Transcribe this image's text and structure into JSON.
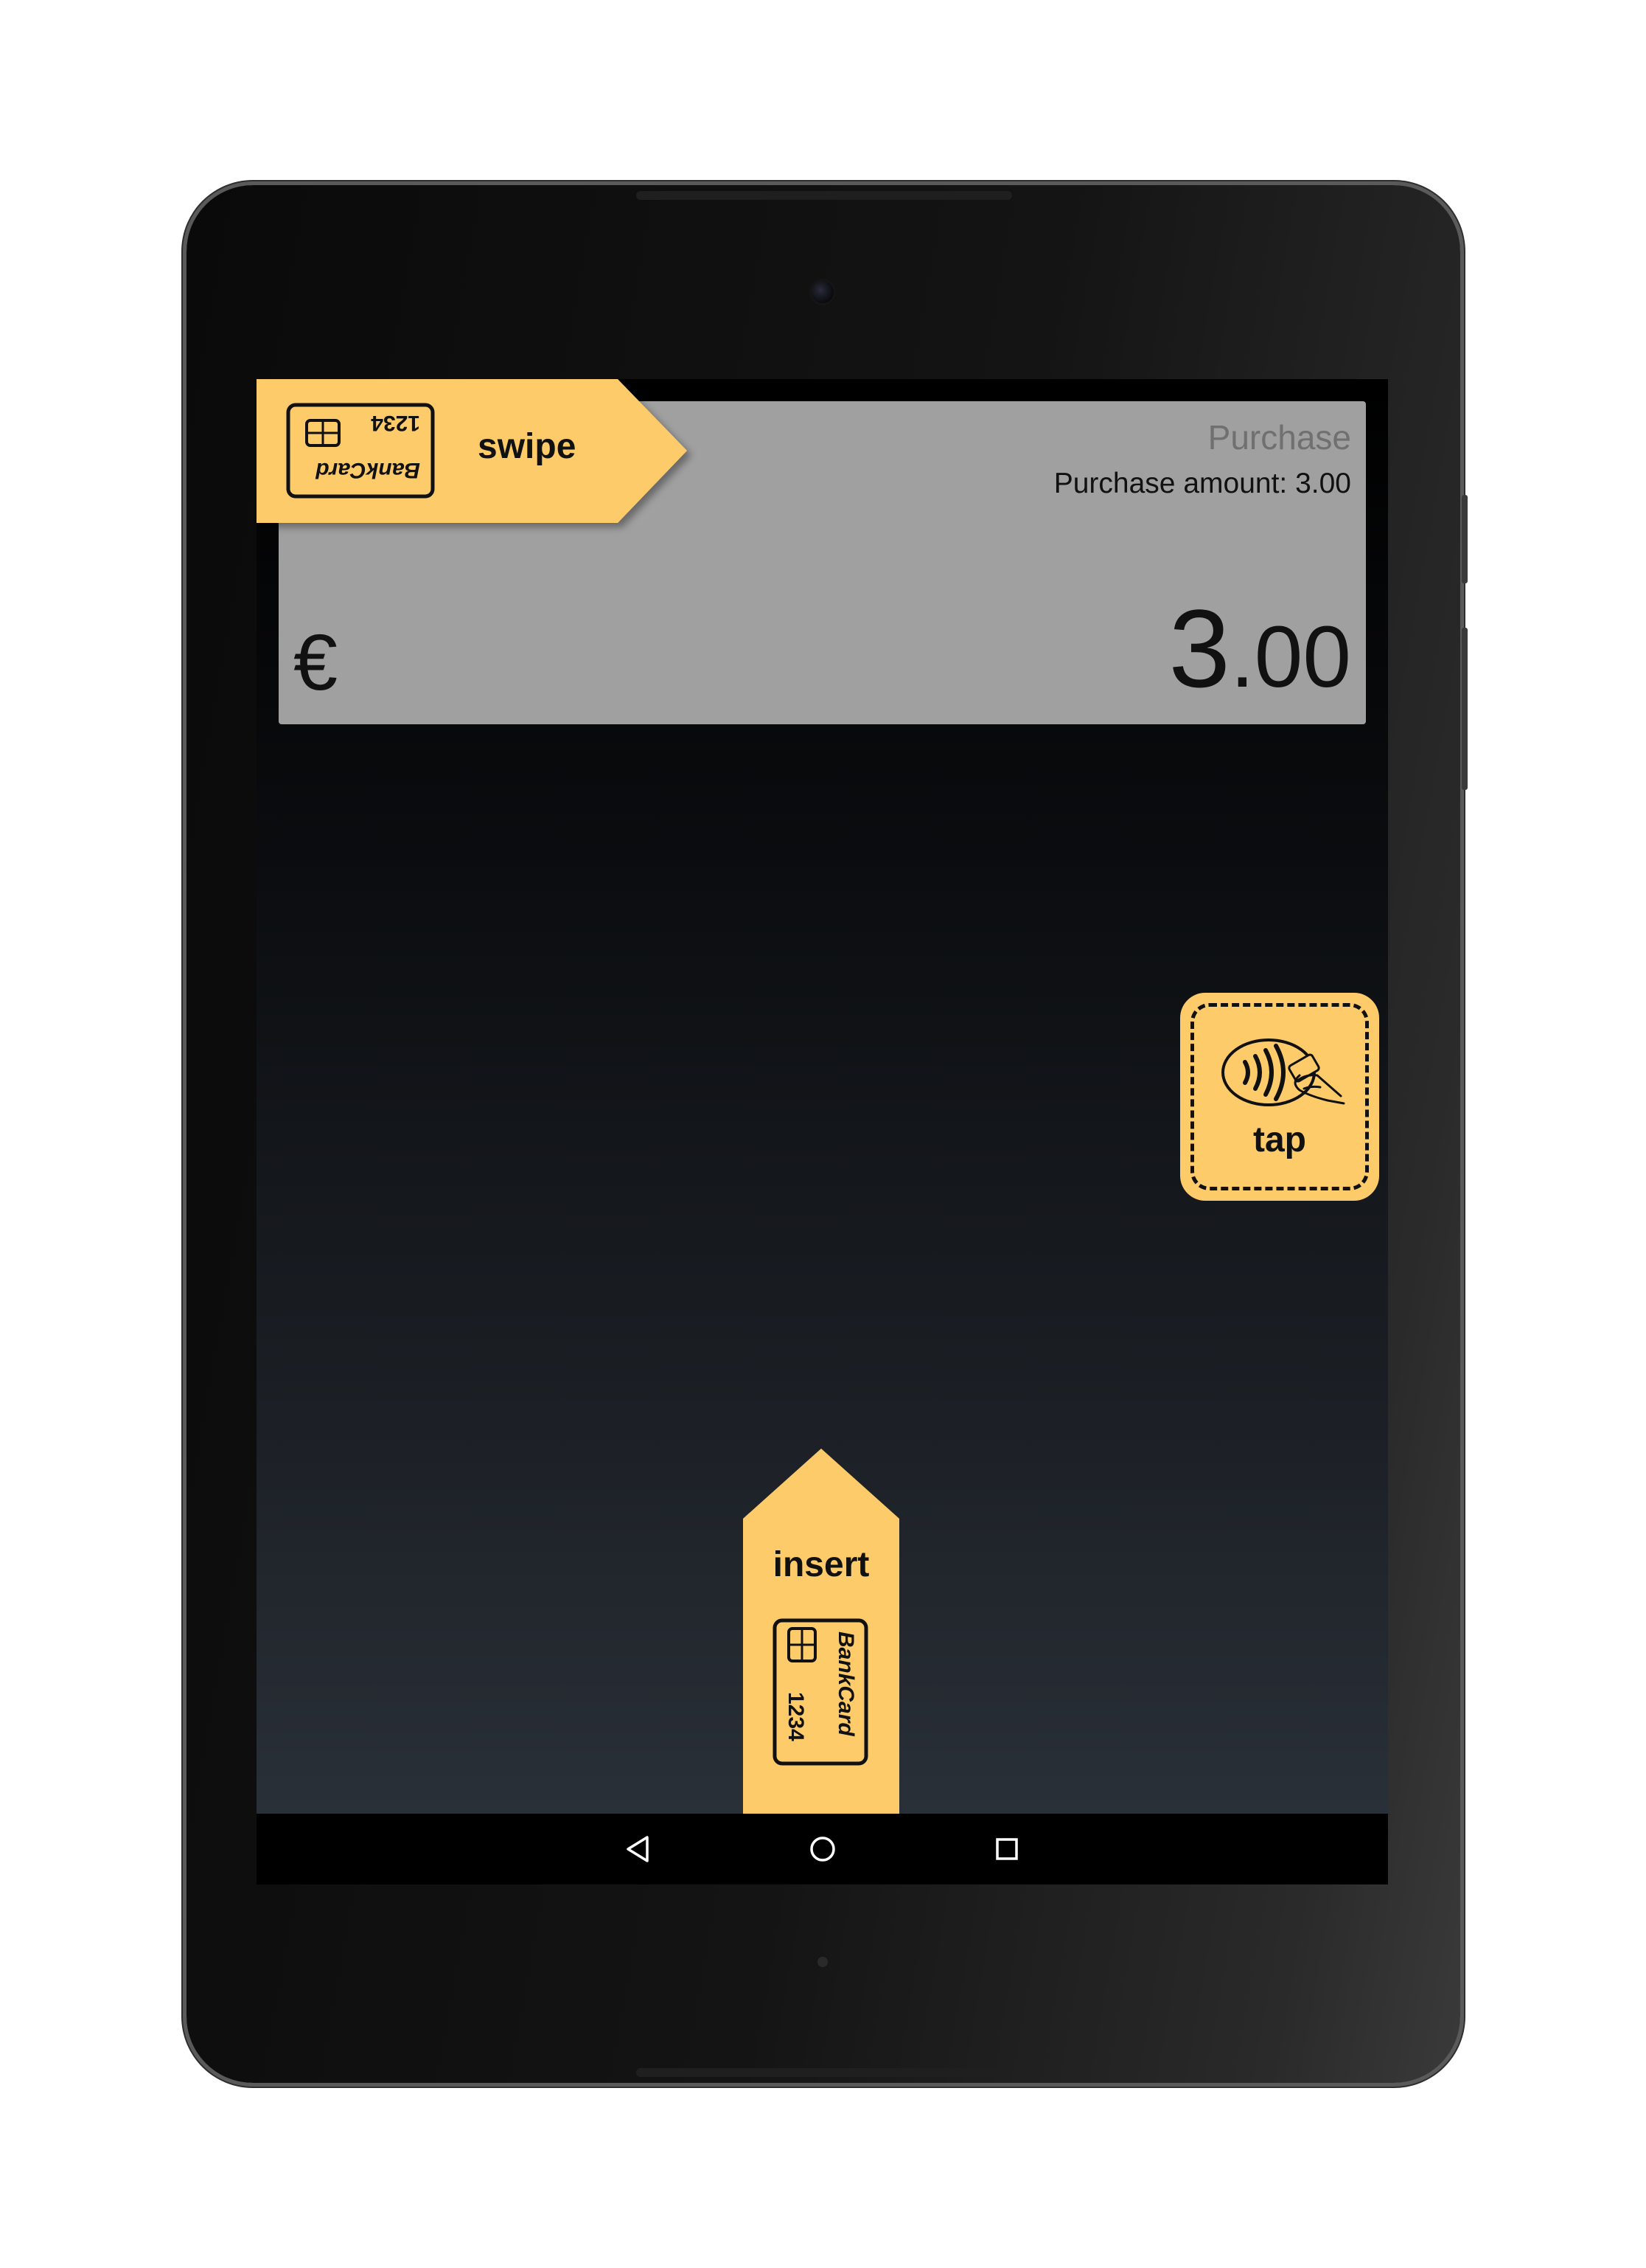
{
  "transaction": {
    "type": "Purchase",
    "detail": "Purchase amount: 3.00",
    "currency_symbol": "€",
    "amount_integer": "3",
    "amount_decimal": ".00"
  },
  "prompts": {
    "swipe_label": "swipe",
    "tap_label": "tap",
    "insert_label": "insert"
  },
  "card": {
    "brand": "BankCard",
    "number": "1234"
  },
  "icons": {
    "contactless": "contactless-icon",
    "back": "back-icon",
    "home": "home-icon",
    "recents": "recents-icon"
  },
  "colors": {
    "accent": "#fdcb6a",
    "panel": "#a0a0a0",
    "muted_text": "#707070"
  }
}
